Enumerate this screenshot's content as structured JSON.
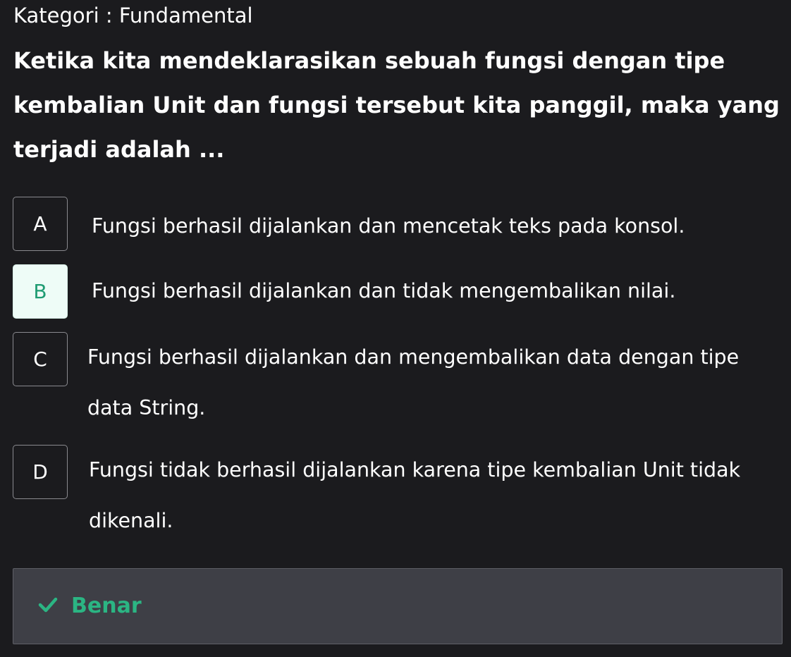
{
  "category_label": "Kategori : Fundamental",
  "question": [
    "Ketika kita mendeklarasikan sebuah fungsi dengan tipe",
    "kembalian Unit dan fungsi tersebut kita panggil, maka yang",
    "terjadi adalah ..."
  ],
  "options": [
    {
      "letter": "A",
      "lines": [
        "Fungsi berhasil dijalankan dan mencetak teks pada konsol."
      ],
      "selected": false
    },
    {
      "letter": "B",
      "lines": [
        "Fungsi berhasil dijalankan dan tidak mengembalikan nilai."
      ],
      "selected": true
    },
    {
      "letter": "C",
      "lines": [
        "Fungsi berhasil dijalankan dan mengembalikan data dengan tipe",
        "data String."
      ],
      "selected": false
    },
    {
      "letter": "D",
      "lines": [
        "Fungsi tidak berhasil dijalankan karena tipe kembalian Unit tidak",
        "dikenali."
      ],
      "selected": false
    }
  ],
  "result": {
    "icon": "check-icon",
    "label": "Benar",
    "color": "#2bb583"
  },
  "colors": {
    "background": "#1b1b1e",
    "selected_bg": "#eefcf7",
    "selected_text": "#1f9c73",
    "result_bg": "#3e3f46"
  }
}
